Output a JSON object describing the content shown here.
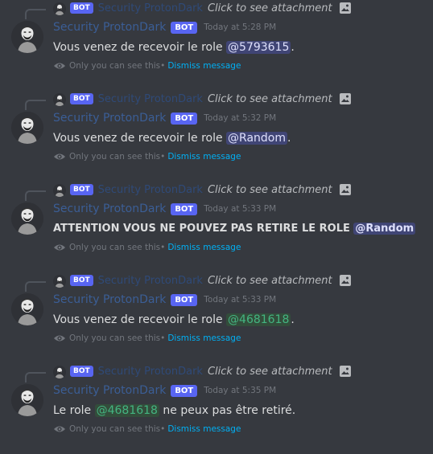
{
  "messages": [
    {
      "reply": {
        "bot_tag": "BOT",
        "username": "Security ProtonDark",
        "text": "Click to see attachment",
        "icon": "image-icon"
      },
      "username": "Security ProtonDark",
      "bot_tag": "BOT",
      "timestamp": "Today at 5:28 PM",
      "content_prefix": "Vous venez de recevoir le role ",
      "mention": "@5793615",
      "mention_style": "blue",
      "content_suffix": ".",
      "ephemeral_text": "Only you can see this",
      "ephemeral_sep": " •",
      "dismiss": "Dismiss message"
    },
    {
      "reply": {
        "bot_tag": "BOT",
        "username": "Security ProtonDark",
        "text": "Click to see attachment",
        "icon": "image-icon"
      },
      "username": "Security ProtonDark",
      "bot_tag": "BOT",
      "timestamp": "Today at 5:32 PM",
      "content_prefix": "Vous venez de recevoir le role ",
      "mention": "@Random",
      "mention_style": "blue",
      "content_suffix": ".",
      "ephemeral_text": "Only you can see this",
      "ephemeral_sep": " •",
      "dismiss": "Dismiss message"
    },
    {
      "reply": {
        "bot_tag": "BOT",
        "username": "Security ProtonDark",
        "text": "Click to see attachment",
        "icon": "image-icon"
      },
      "username": "Security ProtonDark",
      "bot_tag": "BOT",
      "timestamp": "Today at 5:33 PM",
      "content_prefix": "ATTENTION VOUS NE POUVEZ PAS RETIRE LE ROLE ",
      "mention": "@Random",
      "mention_style": "blue",
      "content_suffix": "",
      "ephemeral_text": "Only you can see this",
      "ephemeral_sep": " •",
      "dismiss": "Dismiss message"
    },
    {
      "reply": {
        "bot_tag": "BOT",
        "username": "Security ProtonDark",
        "text": "Click to see attachment",
        "icon": "image-icon"
      },
      "username": "Security ProtonDark",
      "bot_tag": "BOT",
      "timestamp": "Today at 5:33 PM",
      "content_prefix": "Vous venez de recevoir le role ",
      "mention": "@4681618",
      "mention_style": "green",
      "content_suffix": ".",
      "ephemeral_text": "Only you can see this",
      "ephemeral_sep": " •",
      "dismiss": "Dismiss message"
    },
    {
      "reply": {
        "bot_tag": "BOT",
        "username": "Security ProtonDark",
        "text": "Click to see attachment",
        "icon": "image-icon"
      },
      "username": "Security ProtonDark",
      "bot_tag": "BOT",
      "timestamp": "Today at 5:35 PM",
      "content_prefix": "Le role ",
      "mention": "@4681618",
      "mention_style": "green",
      "content_suffix": " ne peux pas être retiré.",
      "ephemeral_text": "Only you can see this",
      "ephemeral_sep": " •",
      "dismiss": "Dismiss message"
    }
  ],
  "colors": {
    "background": "#36393f",
    "username": "#3b5e96",
    "bot_tag": "#5865f2",
    "link": "#00b0f4",
    "muted": "#72767d"
  }
}
